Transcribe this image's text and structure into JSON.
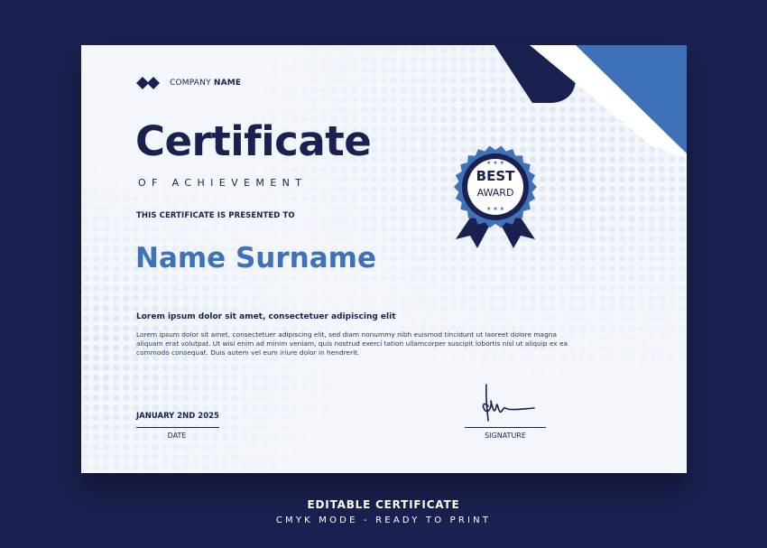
{
  "certificate": {
    "company_prefix": "COMPANY",
    "company_name": "NAME",
    "title": "Certificate",
    "subtitle": "OF ACHIEVEMENT",
    "presented_to": "THIS CERTIFICATE IS PRESENTED TO",
    "recipient_name": "Name Surname",
    "lead_text": "Lorem ipsum dolor sit amet, consectetuer adipiscing elit",
    "body_text": "Lorem ipsum dolor sit amet, consectetuer adipiscing elit, sed diam nonummy nibh euismod tincidunt ut laoreet dolore magna aliquam erat volutpat. Ut wisi enim ad minim veniam, quis nostrud exerci tation ullamcorper suscipit lobortis nisl ut aliquip ex ea commodo consequat. Duis autem vel eum iriure dolor in hendrerit.",
    "date_value": "JANUARY 2ND 2025",
    "date_label": "DATE",
    "signature_label": "SIGNATURE",
    "badge": {
      "line1": "BEST",
      "line2": "AWARD"
    }
  },
  "footer": {
    "line1": "EDITABLE CERTIFICATE",
    "line2": "CMYK MODE - READY TO PRINT"
  },
  "colors": {
    "navy": "#1a2150",
    "accent_blue": "#3f71b9",
    "paper": "#f3f6fb"
  },
  "icons": {
    "logo": "double-diamond-logo-icon",
    "badge": "award-rosette-icon"
  }
}
